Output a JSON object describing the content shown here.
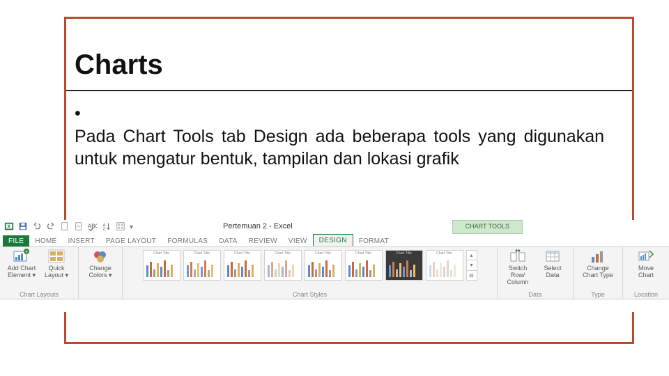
{
  "slide": {
    "title": "Charts",
    "bullet": "•",
    "body": "Pada Chart Tools tab Design ada beberapa tools yang digunakan untuk mengatur bentuk, tampilan dan lokasi grafik"
  },
  "excel": {
    "doc_title": "Pertemuan 2 - Excel",
    "contextual_label": "CHART TOOLS",
    "tabs": {
      "file": "FILE",
      "home": "HOME",
      "insert": "INSERT",
      "page_layout": "PAGE LAYOUT",
      "formulas": "FORMULAS",
      "data": "DATA",
      "review": "REVIEW",
      "view": "VIEW",
      "design": "DESIGN",
      "format": "FORMAT"
    },
    "groups": {
      "chart_layouts": {
        "label": "Chart Layouts",
        "add_element": "Add Chart Element ▾",
        "quick_layout": "Quick Layout ▾"
      },
      "change_colors": "Change Colors ▾",
      "chart_styles": {
        "label": "Chart Styles",
        "thumb_title": "Chart Title"
      },
      "data": {
        "label": "Data",
        "switch": "Switch Row/ Column",
        "select": "Select Data"
      },
      "type": {
        "label": "Type",
        "change": "Change Chart Type"
      },
      "location": {
        "label": "Location",
        "move": "Move Chart"
      }
    }
  }
}
